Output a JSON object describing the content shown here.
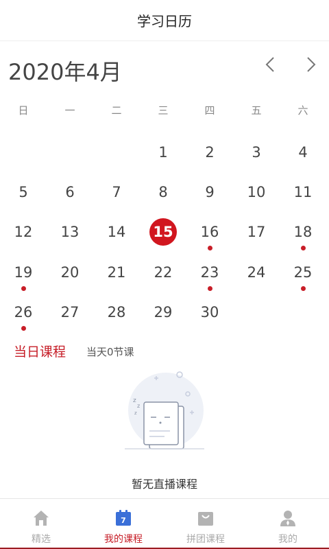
{
  "header": {
    "title": "学习日历"
  },
  "calendar": {
    "month_label": "2020年4月",
    "weekdays": [
      "日",
      "一",
      "二",
      "三",
      "四",
      "五",
      "六"
    ],
    "selected_day": 15,
    "days": [
      {
        "num": "1",
        "col": 3,
        "row": 0,
        "dot": false
      },
      {
        "num": "2",
        "col": 4,
        "row": 0,
        "dot": false
      },
      {
        "num": "3",
        "col": 5,
        "row": 0,
        "dot": false
      },
      {
        "num": "4",
        "col": 6,
        "row": 0,
        "dot": false
      },
      {
        "num": "5",
        "col": 0,
        "row": 1,
        "dot": false
      },
      {
        "num": "6",
        "col": 1,
        "row": 1,
        "dot": false
      },
      {
        "num": "7",
        "col": 2,
        "row": 1,
        "dot": false
      },
      {
        "num": "8",
        "col": 3,
        "row": 1,
        "dot": false
      },
      {
        "num": "9",
        "col": 4,
        "row": 1,
        "dot": false
      },
      {
        "num": "10",
        "col": 5,
        "row": 1,
        "dot": false
      },
      {
        "num": "11",
        "col": 6,
        "row": 1,
        "dot": false
      },
      {
        "num": "12",
        "col": 0,
        "row": 2,
        "dot": false
      },
      {
        "num": "13",
        "col": 1,
        "row": 2,
        "dot": false
      },
      {
        "num": "14",
        "col": 2,
        "row": 2,
        "dot": false
      },
      {
        "num": "15",
        "col": 3,
        "row": 2,
        "dot": false
      },
      {
        "num": "16",
        "col": 4,
        "row": 2,
        "dot": true
      },
      {
        "num": "17",
        "col": 5,
        "row": 2,
        "dot": false
      },
      {
        "num": "18",
        "col": 6,
        "row": 2,
        "dot": true
      },
      {
        "num": "19",
        "col": 0,
        "row": 3,
        "dot": true
      },
      {
        "num": "20",
        "col": 1,
        "row": 3,
        "dot": false
      },
      {
        "num": "21",
        "col": 2,
        "row": 3,
        "dot": false
      },
      {
        "num": "22",
        "col": 3,
        "row": 3,
        "dot": false
      },
      {
        "num": "23",
        "col": 4,
        "row": 3,
        "dot": true
      },
      {
        "num": "24",
        "col": 5,
        "row": 3,
        "dot": false
      },
      {
        "num": "25",
        "col": 6,
        "row": 3,
        "dot": true
      },
      {
        "num": "26",
        "col": 0,
        "row": 4,
        "dot": true
      },
      {
        "num": "27",
        "col": 1,
        "row": 4,
        "dot": false
      },
      {
        "num": "28",
        "col": 2,
        "row": 4,
        "dot": false
      },
      {
        "num": "29",
        "col": 3,
        "row": 4,
        "dot": false
      },
      {
        "num": "30",
        "col": 4,
        "row": 4,
        "dot": false
      }
    ]
  },
  "daily": {
    "title": "当日课程",
    "count_text": "当天0节课",
    "empty_text": "暂无直播课程"
  },
  "tabbar": {
    "items": [
      {
        "label": "精选",
        "icon": "home-icon",
        "active": false
      },
      {
        "label": "我的课程",
        "icon": "calendar-icon",
        "active": true
      },
      {
        "label": "拼团课程",
        "icon": "shopping-bag-icon",
        "active": false
      },
      {
        "label": "我的",
        "icon": "user-icon",
        "active": false
      }
    ]
  },
  "colors": {
    "accent": "#c61c26",
    "selected_day_bg": "#d1161f",
    "dot": "#c81e28",
    "tab_icon_inactive": "#b3b3b3",
    "tab_icon_active": "#3a6fd8"
  }
}
